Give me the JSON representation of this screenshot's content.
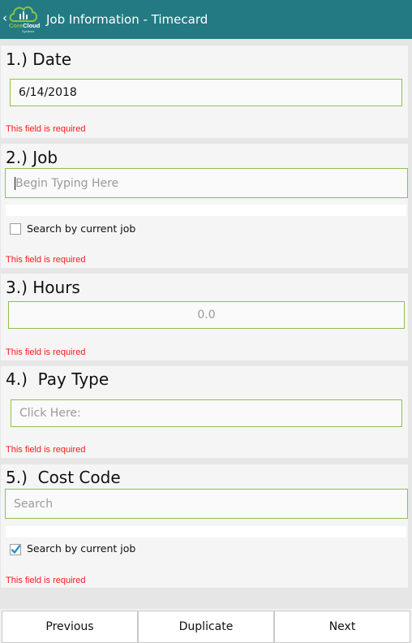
{
  "header": {
    "back_glyph": "‹",
    "logo_word_core": "Core",
    "logo_word_cloud": "Cloud",
    "logo_sub": "Systems",
    "title": "Job Information - Timecard"
  },
  "sections": {
    "date": {
      "label": "1.) Date",
      "value": "6/14/2018",
      "error": "This field is required"
    },
    "job": {
      "label": "2.) Job",
      "placeholder": "Begin Typing Here",
      "checkbox_label": "Search by current job",
      "checkbox_checked": false,
      "error": "This field is required"
    },
    "hours": {
      "label": "3.) Hours",
      "placeholder": "0.0",
      "error": "This field is required"
    },
    "pay_type": {
      "label": "4.)  Pay Type",
      "placeholder": "Click Here:",
      "error": "This field is required"
    },
    "cost_code": {
      "label": "5.)  Cost Code",
      "placeholder": "Search",
      "checkbox_label": "Search by current job",
      "checkbox_checked": true,
      "error": "This field is required"
    }
  },
  "footer": {
    "previous_label": "Previous",
    "duplicate_label": "Duplicate",
    "next_label": "Next"
  },
  "colors": {
    "header_bg": "#247a82",
    "field_border": "#8bc34a",
    "error": "#ff1a1a",
    "checkbox_checked": "#2f8fd0"
  },
  "icons": {
    "back": "chevron-left-icon",
    "logo": "core-cloud-logo",
    "checkbox_checked": "checkmark-icon"
  }
}
